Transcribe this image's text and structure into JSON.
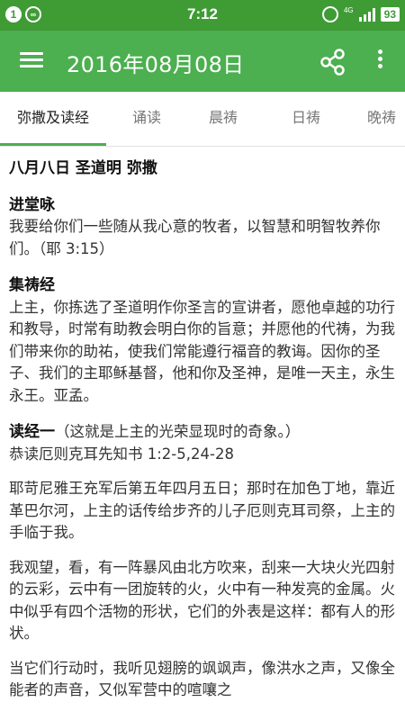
{
  "status_bar": {
    "notif_1": "1",
    "time": "7:12",
    "network": "4G",
    "battery": "93"
  },
  "toolbar": {
    "title": "2016年08月08日"
  },
  "tabs": [
    {
      "label": "弥撒及读经"
    },
    {
      "label": "诵读"
    },
    {
      "label": "晨祷"
    },
    {
      "label": "日祷"
    },
    {
      "label": "晚祷"
    }
  ],
  "content": {
    "date_heading": "八月八日 圣道明 弥撒",
    "entrance": {
      "title": "进堂咏",
      "text": "我要给你们一些随从我心意的牧者，以智慧和明智牧养你们。（耶 3:15）"
    },
    "collect": {
      "title": "集祷经",
      "text": "上主，你拣选了圣道明作你圣言的宣讲者，愿他卓越的功行和教导，时常有助教会明白你的旨意；并愿他的代祷，为我们带来你的助祐，使我们常能遵行福音的教诲。因你的圣子、我们的主耶稣基督，他和你及圣神，是唯一天主，永生永王。亚孟。"
    },
    "reading1": {
      "title": "读经一",
      "note": "（这就是上主的光荣显现时的奇象。）",
      "source": "恭读厄则克耳先知书 1:2-5,24-28",
      "paragraphs": [
        "耶苛尼雅王充军后第五年四月五日；那时在加色丁地，靠近革巴尔河，上主的话传给步齐的儿子厄则克耳司祭，上主的手临于我。",
        "我观望，看，有一阵暴风由北方吹来，刮来一大块火光四射的云彩，云中有一团旋转的火，火中有一种发亮的金属。火中似乎有四个活物的形状，它们的外表是这样：都有人的形状。",
        "当它们行动时，我听见翅膀的飒飒声，像洪水之声，又像全能者的声音，又似军营中的喧嚷之"
      ]
    }
  },
  "colors": {
    "status_bar": "#3f9c35",
    "toolbar": "#4caf50",
    "accent": "#4caf50"
  },
  "icons": [
    "menu-icon",
    "share-icon",
    "more-vert-icon",
    "alarm-icon",
    "signal-icon",
    "battery-icon"
  ]
}
